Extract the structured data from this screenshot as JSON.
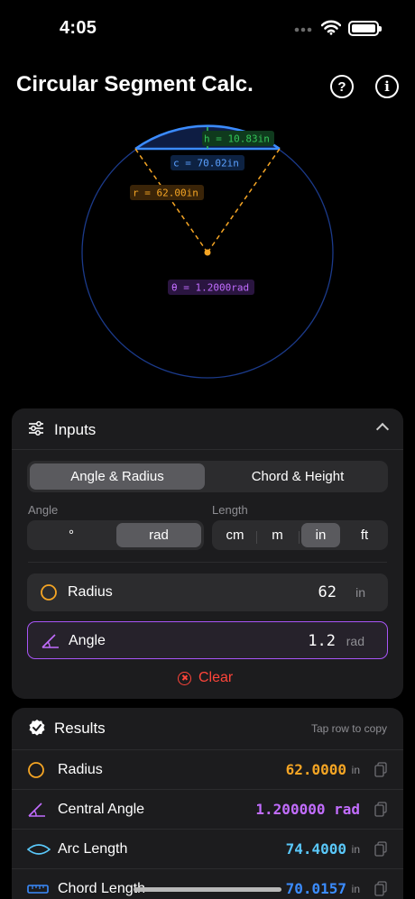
{
  "status": {
    "time": "4:05"
  },
  "header": {
    "title": "Circular Segment Calc.",
    "help_glyph": "?",
    "info_glyph": "i"
  },
  "diagram": {
    "height_label": "h = 10.83in",
    "chord_label": "c = 70.02in",
    "radius_label": "r = 62.00in",
    "angle_label": "θ = 1.2000rad"
  },
  "inputs": {
    "title": "Inputs",
    "mode_tabs": [
      "Angle & Radius",
      "Chord & Height"
    ],
    "active_mode": "Angle & Radius",
    "angle_label": "Angle",
    "angle_units": [
      "°",
      "rad"
    ],
    "active_angle_unit": "rad",
    "length_label": "Length",
    "length_units": [
      "cm",
      "m",
      "in",
      "ft"
    ],
    "active_length_unit": "in",
    "fields": [
      {
        "label": "Radius",
        "value": "62",
        "unit": "in",
        "icon": "circle-icon"
      },
      {
        "label": "Angle",
        "value": "1.2",
        "unit": "rad",
        "icon": "angle-icon"
      }
    ],
    "clear_label": "Clear"
  },
  "results": {
    "title": "Results",
    "hint": "Tap row to copy",
    "rows": [
      {
        "label": "Radius",
        "value": "62.0000",
        "unit": "in",
        "color": "#f5a524",
        "icon": "circle-icon"
      },
      {
        "label": "Central Angle",
        "value": "1.200000 rad",
        "unit": "",
        "color": "#c26dff",
        "icon": "angle-icon"
      },
      {
        "label": "Arc Length",
        "value": "74.4000",
        "unit": "in",
        "color": "#5ac8fa",
        "icon": "lens-icon"
      },
      {
        "label": "Chord Length",
        "value": "70.0157",
        "unit": "in",
        "color": "#3b8cff",
        "icon": "ruler-icon"
      }
    ]
  },
  "colors": {
    "radius": "#f5a524",
    "angle": "#c26dff",
    "arc": "#3b8cff",
    "height": "#34c759",
    "danger": "#ff453a"
  }
}
